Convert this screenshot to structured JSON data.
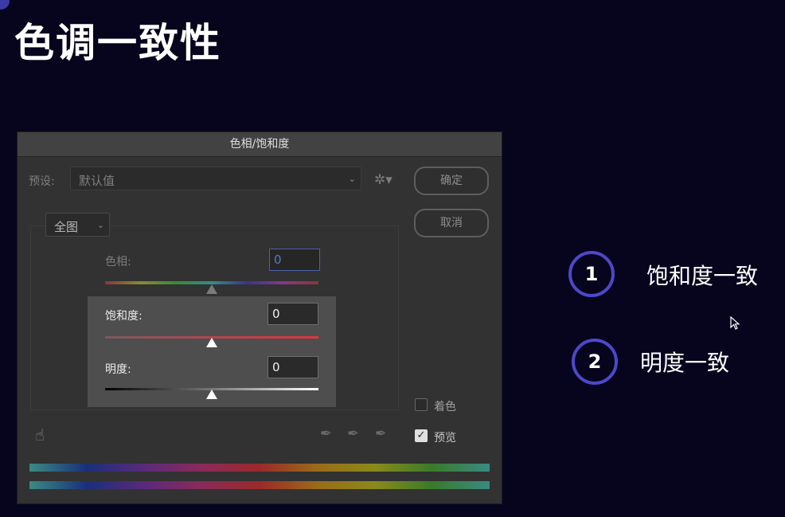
{
  "page": {
    "title": "色调一致性"
  },
  "dialog": {
    "title": "色相/饱和度",
    "preset_label": "预设:",
    "preset_value": "默认值",
    "ok_label": "确定",
    "cancel_label": "取消",
    "range_value": "全图",
    "hue": {
      "label": "色相:",
      "value": "0",
      "slider_level": 0.5
    },
    "saturation": {
      "label": "饱和度:",
      "value": "0",
      "slider_level": 0.5
    },
    "lightness": {
      "label": "明度:",
      "value": "0",
      "slider_level": 0.5
    },
    "colorize_label": "着色",
    "colorize_checked": false,
    "preview_label": "预览",
    "preview_checked": true,
    "icons": [
      "hand-target-icon",
      "eyedropper-icon",
      "eyedropper-plus-icon",
      "eyedropper-minus-icon",
      "gear-icon",
      "chevron-down-icon",
      "check-icon"
    ]
  },
  "annotations": [
    {
      "number": "1",
      "text": "饱和度一致"
    },
    {
      "number": "2",
      "text": "明度一致"
    }
  ],
  "colors": {
    "background": "#07041e",
    "bullet_ring": "#4d48c9",
    "dialog_bg": "#323232"
  }
}
